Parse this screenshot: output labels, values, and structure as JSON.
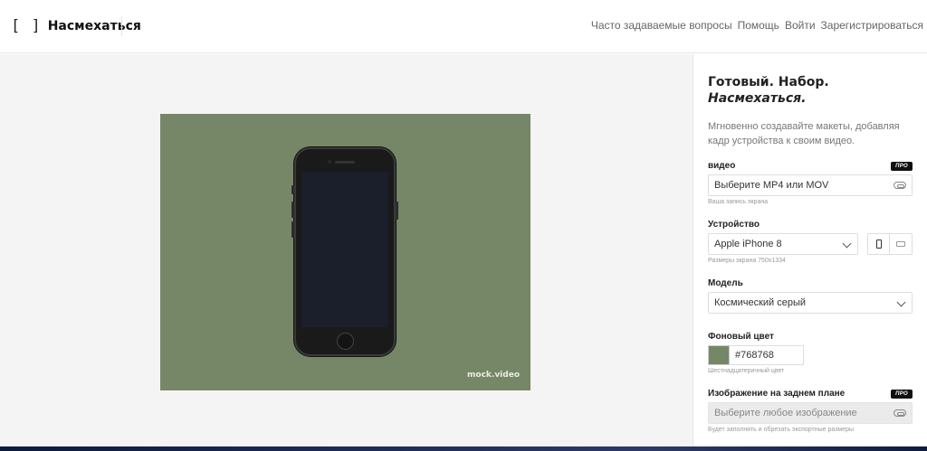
{
  "header": {
    "logo_mark": "[ ]",
    "logo_text": "Насмехаться",
    "nav": [
      {
        "label": "Часто задаваемые вопросы"
      },
      {
        "label": "Помощь"
      },
      {
        "label": "Войти"
      },
      {
        "label": "Зарегистрироваться"
      }
    ]
  },
  "preview": {
    "background_color": "#768768",
    "watermark": "mock.video"
  },
  "panel": {
    "title_line1": "Готовый. Набор.",
    "title_line2": "Насмехаться.",
    "subtitle": "Мгновенно создавайте макеты, добавляя кадр устройства к своим видео.",
    "video": {
      "label": "видео",
      "badge": "ПРО",
      "placeholder": "Выберите MP4 или MOV",
      "hint": "Ваша запись экрана",
      "icon": "paperclip-icon"
    },
    "device": {
      "label": "Устройство",
      "value": "Apple iPhone 8",
      "hint": "Размеры экрана 750х1334",
      "orientations": [
        "portrait-icon",
        "landscape-icon"
      ]
    },
    "model": {
      "label": "Модель",
      "value": "Космический серый"
    },
    "bg_color": {
      "label": "Фоновый цвет",
      "value": "#768768",
      "hint": "Шестнадцатеричный цвет"
    },
    "bg_image": {
      "label": "Изображение на заднем плане",
      "badge": "ПРО",
      "placeholder": "Выберите любое изображение",
      "hint": "Будет заполнять и обрезать экспортные размеры",
      "icon": "paperclip-icon"
    }
  }
}
